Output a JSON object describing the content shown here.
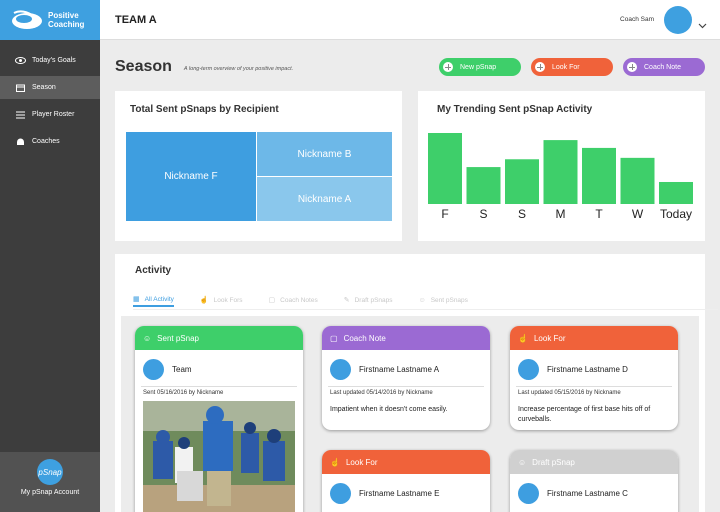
{
  "brand": {
    "line1": "Positive",
    "line2": "Coaching",
    "accent": "#3ea0e0"
  },
  "sidebar": {
    "items": [
      {
        "label": "Today's Goals",
        "icon": "eye-icon"
      },
      {
        "label": "Season",
        "icon": "calendar-icon",
        "active": true
      },
      {
        "label": "Player Roster",
        "icon": "list-icon"
      },
      {
        "label": "Coaches",
        "icon": "helmet-icon"
      }
    ],
    "footer": {
      "logo_text": "pSnap",
      "label": "My pSnap Account"
    }
  },
  "topbar": {
    "team": "TEAM A",
    "coach": "Coach Sam"
  },
  "page": {
    "title": "Season",
    "subtitle": "A long-term overview of your positive impact.",
    "buttons": {
      "new_psnap": "New pSnap",
      "look_for": "Look For",
      "coach_note": "Coach Note"
    }
  },
  "treemap_card": {
    "title": "Total Sent pSnaps by Recipient",
    "blocks": {
      "f": "Nickname F",
      "b": "Nickname B",
      "a": "Nickname A"
    }
  },
  "chart_data": {
    "type": "bar",
    "title": "My Trending Sent pSnap Activity",
    "categories": [
      "F",
      "S",
      "S",
      "M",
      "T",
      "W",
      "Today"
    ],
    "values": [
      100,
      52,
      63,
      90,
      79,
      65,
      31
    ],
    "ylim": [
      0,
      100
    ],
    "color": "#3ecf6a",
    "grid": false
  },
  "activity": {
    "title": "Activity",
    "tabs": [
      "All Activity",
      "Look Fors",
      "Coach Notes",
      "Draft pSnaps",
      "Sent pSnaps"
    ],
    "cards": [
      {
        "type": "Sent pSnap",
        "name": "Team",
        "meta": "Sent 05/16/2016 by Nickname",
        "text": ""
      },
      {
        "type": "Coach Note",
        "name": "Firstname Lastname A",
        "meta": "Last updated 05/14/2016 by Nickname",
        "text": "Impatient when it doesn't come easily."
      },
      {
        "type": "Look For",
        "name": "Firstname Lastname D",
        "meta": "Last updated 05/15/2016 by Nickname",
        "text": "Increase percentage of first base hits off of curveballs."
      },
      {
        "type": "Look For",
        "name": "Firstname Lastname E",
        "meta": "",
        "text": ""
      },
      {
        "type": "Draft pSnap",
        "name": "Firstname Lastname C",
        "meta": "",
        "text": ""
      }
    ]
  },
  "colors": {
    "green": "#3ecf6a",
    "orange": "#f0623a",
    "purple": "#9b6ad3",
    "gray": "#d0d0d0",
    "blue": "#3e9ee0"
  }
}
